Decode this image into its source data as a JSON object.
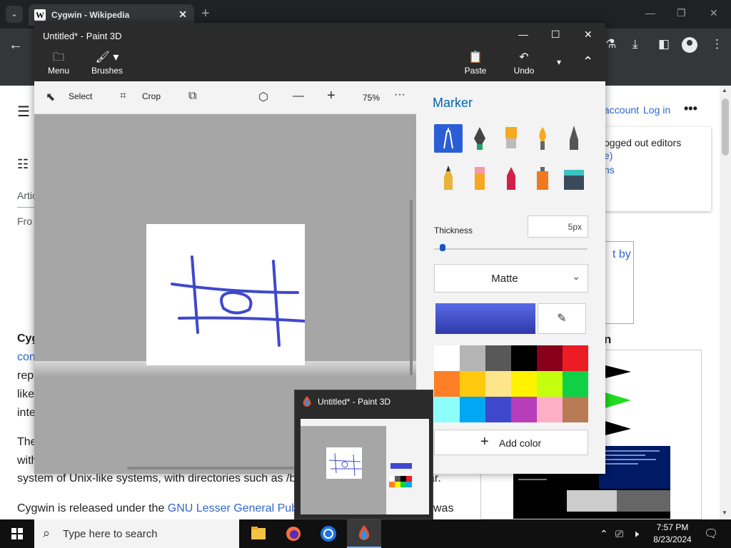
{
  "browser": {
    "tab_title": "Cygwin - Wikipedia",
    "favicon_letter": "W",
    "new_tab": "+",
    "tab_close": "✕"
  },
  "wiki": {
    "article_tab": "Artic",
    "from_text": "Fro",
    "heading_fragment": "Cyg",
    "cont_link": "con",
    "line_rep": "rep",
    "line_like": "like",
    "line_inte": "inte",
    "line_the": "The",
    "line_with": "with",
    "line_system": "system of Unix-like systems, with directories such as /b",
    "line_system_end": "ar.",
    "line_license_prefix": "Cygwin is released under the ",
    "line_license_link": "GNU Lesser General Pub",
    "line_license_end": "was",
    "create_account": "account",
    "login": "Log in",
    "more_menu": "•••",
    "logged_out_text": "ogged out editors",
    "logged_e": "e)",
    "logged_ns": "ns",
    "infobox_by": "t by",
    "infobox_n": "n"
  },
  "paint": {
    "window_title": "Untitled* - Paint 3D",
    "menu_label": "Menu",
    "brushes_label": "Brushes",
    "paste_label": "Paste",
    "undo_label": "Undo",
    "select_label": "Select",
    "crop_label": "Crop",
    "zoom": "75%",
    "more_tools": "···",
    "panel_title": "Marker",
    "thickness_label": "Thickness",
    "thickness_value": "5px",
    "finish_value": "Matte",
    "add_color_label": "Add color",
    "selected_color": "#3f48cc",
    "palette": [
      "#ffffff",
      "#b4b4b4",
      "#585858",
      "#000000",
      "#88001b",
      "#ec1c24",
      "#ff7f27",
      "#ffc90e",
      "#fde58a",
      "#fff200",
      "#c4ff0e",
      "#0ed145",
      "#8cfffb",
      "#00a8f3",
      "#3f48cc",
      "#b83dba",
      "#ffaec8",
      "#b97a56"
    ]
  },
  "preview": {
    "title": "Untitled* - Paint 3D"
  },
  "taskbar": {
    "search_placeholder": "Type here to search",
    "time": "7:57 PM",
    "date": "8/23/2024"
  }
}
